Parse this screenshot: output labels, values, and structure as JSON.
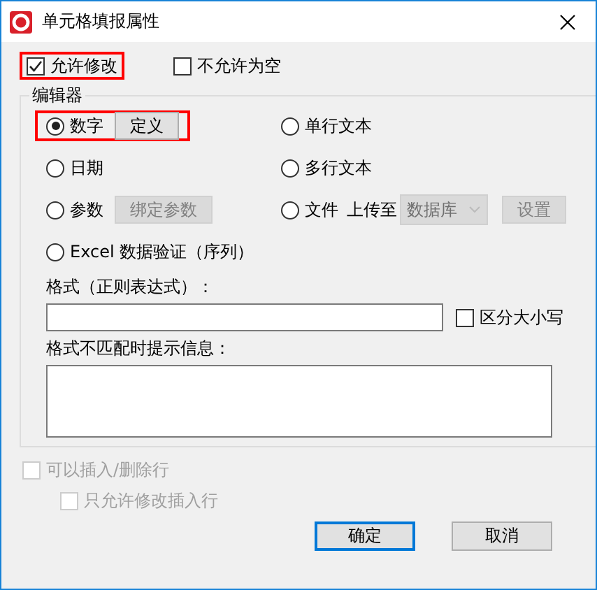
{
  "window": {
    "title": "单元格填报属性"
  },
  "options": [
    {
      "label": "允许修改",
      "checked": true,
      "highlighted": true
    },
    {
      "label": "不允许为空",
      "checked": false,
      "highlighted": false
    }
  ],
  "editor": {
    "title": "编辑器",
    "types": [
      {
        "label": "数字",
        "selected": true,
        "highlighted": true,
        "button": {
          "label": "定义",
          "disabled": false
        }
      },
      {
        "label": "单行文本",
        "selected": false,
        "highlighted": false
      },
      {
        "label": "日期",
        "selected": false,
        "highlighted": false
      },
      {
        "label": "多行文本",
        "selected": false,
        "highlighted": false
      },
      {
        "label": "参数",
        "selected": false,
        "highlighted": false,
        "button": {
          "label": "绑定参数",
          "disabled": true
        }
      },
      {
        "label": "文件",
        "selected": false,
        "highlighted": false,
        "upload": {
          "label": "上传至",
          "dropdown": {
            "value": "数据库",
            "disabled": true
          },
          "button": {
            "label": "设置",
            "disabled": true
          }
        }
      },
      {
        "label": "Excel 数据验证（序列）",
        "selected": false,
        "highlighted": false,
        "wide": true
      }
    ],
    "format_label": "格式（正则表达式）：",
    "case_sensitive": {
      "label": "区分大小写",
      "checked": false
    },
    "message_label": "格式不匹配时提示信息："
  },
  "row_options": [
    {
      "label": "可以插入/删除行",
      "checked": false,
      "disabled": true,
      "children": [
        {
          "label": "只允许修改插入行",
          "checked": false,
          "disabled": true
        }
      ]
    }
  ],
  "buttons": [
    {
      "label": "确定",
      "default": true
    },
    {
      "label": "取消",
      "default": false
    }
  ]
}
